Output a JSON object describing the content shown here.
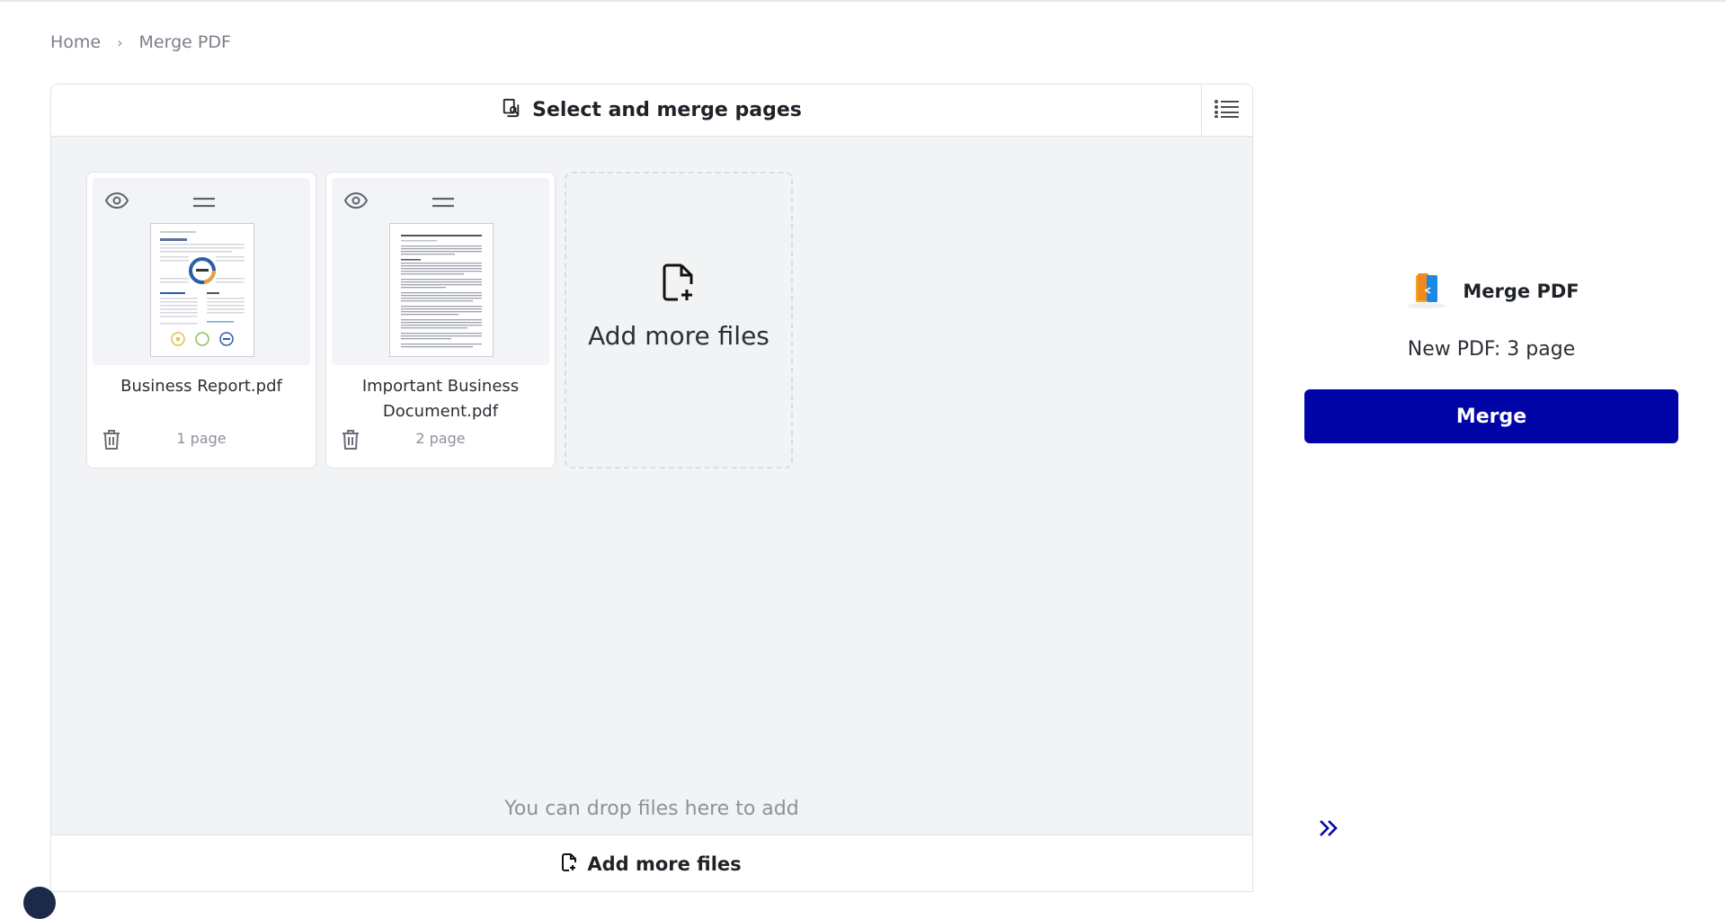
{
  "breadcrumb": {
    "home": "Home",
    "separator": "›",
    "current": "Merge PDF"
  },
  "workspace": {
    "title": "Select and merge pages",
    "files": [
      {
        "name": "Business Report.pdf",
        "pages": "1 page"
      },
      {
        "name": "Important Business Document.pdf",
        "pages": "2 page"
      }
    ],
    "add_card_label": "Add more files",
    "drop_hint": "You can drop files here to add",
    "footer_label": "Add more files"
  },
  "right_panel": {
    "tool_name": "Merge PDF",
    "new_pdf": "New PDF: 3 page",
    "merge_label": "Merge"
  },
  "colors": {
    "accent": "#0005a8",
    "workspace_bg": "#f1f3f5",
    "border": "#dfe3e8"
  },
  "icons": [
    "select-pages-icon",
    "list-view-icon",
    "eye-icon",
    "drag-handle-icon",
    "trash-icon",
    "add-file-icon",
    "merge-pdf-logo-icon",
    "double-chevron-right-icon"
  ]
}
